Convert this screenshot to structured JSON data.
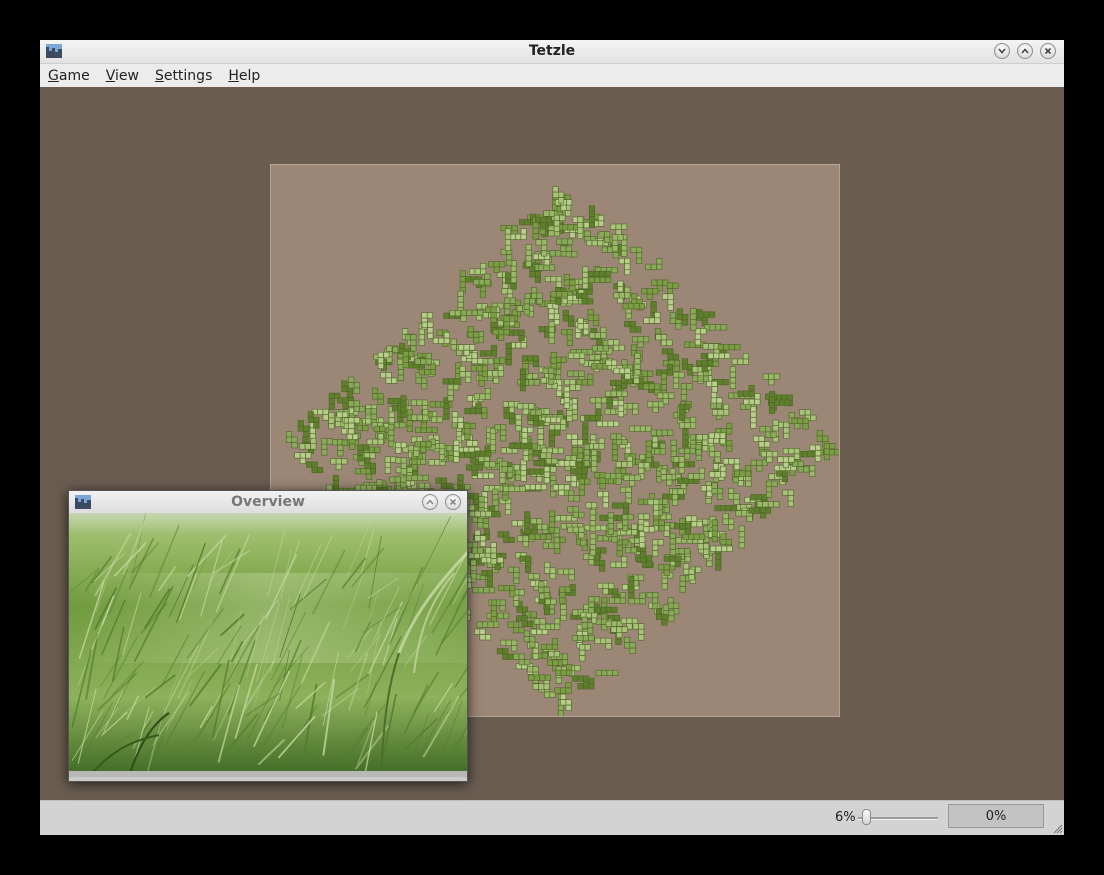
{
  "window": {
    "title": "Tetzle",
    "buttons": [
      "minimize",
      "maximize",
      "close"
    ]
  },
  "menu": {
    "items": [
      {
        "mnemonic": "G",
        "rest": "ame"
      },
      {
        "mnemonic": "V",
        "rest": "iew"
      },
      {
        "mnemonic": "S",
        "rest": "ettings"
      },
      {
        "mnemonic": "H",
        "rest": "elp"
      }
    ]
  },
  "overview": {
    "title": "Overview"
  },
  "status": {
    "zoom_label": "6%",
    "zoom_level": 0.06,
    "progress_text": "0%",
    "progress_value": 0
  },
  "icons": {
    "app": "tetzle-app-icon",
    "minimize": "chevron-down-icon",
    "maximize": "chevron-up-icon",
    "close": "close-icon",
    "resize": "resize-grip-icon"
  },
  "colors": {
    "canvas": "#6a5d50",
    "board": "#9c8776",
    "piece_light": "#a9c27a",
    "piece_dark": "#5f7f2c"
  }
}
